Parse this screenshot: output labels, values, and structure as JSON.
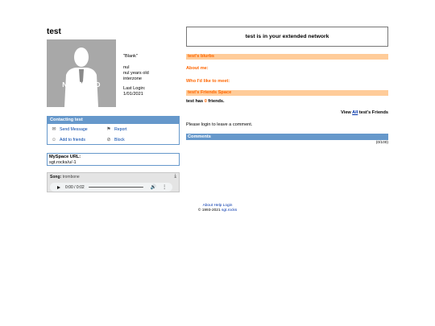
{
  "profile": {
    "name": "test",
    "photo_label": "NO PHOTO",
    "quote": "\"Blank\"",
    "gender": "nul",
    "age": "nul years old",
    "location": "interzone",
    "last_login_label": "Last Login:",
    "last_login_date": "1/01/2021"
  },
  "contact": {
    "header": "Contacting test",
    "items": [
      {
        "label": "Send Message",
        "icon": "envelope-icon"
      },
      {
        "label": "Report",
        "icon": "report-icon"
      },
      {
        "label": "Add to friends",
        "icon": "add-friend-icon"
      },
      {
        "label": "Block",
        "icon": "block-icon"
      }
    ]
  },
  "myspace_url": {
    "label": "MySpace URL:",
    "value": "sgt.rocks/u/-1"
  },
  "song": {
    "label": "Song:",
    "title": "trombone",
    "time": "0:00 / 0:02"
  },
  "main": {
    "network_text": "test is in your extended network",
    "blurbs_header": "test's blurbs",
    "about_label": "About me:",
    "meet_label": "Who I'd like to meet:",
    "friends_space_header": "test's Friends Space",
    "friends_prefix": "test has ",
    "friends_count": "0",
    "friends_suffix": " friends.",
    "view_prefix": "View ",
    "view_all": "All",
    "view_suffix": " test's Friends",
    "login_note": "Please login to leave a comment.",
    "comments_header": "Comments",
    "comments_count": "(0/100)"
  },
  "footer": {
    "links": [
      "About",
      "Help",
      "Login"
    ],
    "copyright": "© 1993-2021 ",
    "site_link": "sgt.rocks"
  },
  "colors": {
    "accent_blue": "#6698cb",
    "orange": "#ff6600",
    "orange_bg": "#ffcc99",
    "link": "#0033aa"
  }
}
